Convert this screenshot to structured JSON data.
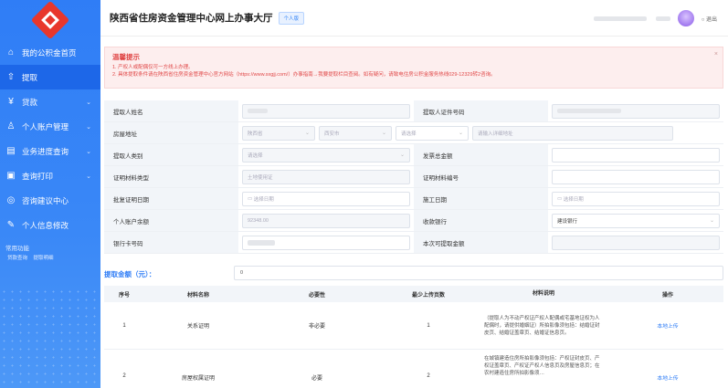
{
  "app": {
    "title": "陕西省住房资金管理中心网上办事大厅",
    "tag": "个人版",
    "logout": "退出"
  },
  "colors": {
    "accent": "#2f7df6",
    "danger": "#e04848",
    "logo": "#e8372c"
  },
  "sidebar": {
    "items": [
      {
        "label": "我的公积金首页",
        "icon": "home-icon",
        "arrow": ""
      },
      {
        "label": "提取",
        "icon": "upload-icon",
        "arrow": ""
      },
      {
        "label": "贷款",
        "icon": "loan-icon",
        "arrow": "⌄"
      },
      {
        "label": "个人账户管理",
        "icon": "user-icon",
        "arrow": "⌄"
      },
      {
        "label": "业务进度查询",
        "icon": "progress-icon",
        "arrow": "⌄"
      },
      {
        "label": "查询打印",
        "icon": "print-icon",
        "arrow": "⌄"
      },
      {
        "label": "咨询建议中心",
        "icon": "chat-icon",
        "arrow": ""
      },
      {
        "label": "个人信息修改",
        "icon": "edit-icon",
        "arrow": ""
      }
    ],
    "common_title": "常用功能",
    "common_links": [
      "贷款查询",
      "提取明细"
    ]
  },
  "notice": {
    "title": "温馨提示",
    "line1": "1. 产权人或配偶仅可一方线上办理。",
    "line2": "2. 具体提取条件请在陕西省住房资金管理中心官方网站（https://www.sxgjj.com/）办事指南→我要提取栏目查阅。如有疑问，请致电住房公积金服务热线029-12329转2咨询。",
    "close": "×"
  },
  "form": {
    "name_label": "提取人姓名",
    "idno_label": "提取人证件号码",
    "address_label": "房屋地址",
    "address": {
      "province": "陕西省",
      "city": "西安市",
      "district": "请选择",
      "detail": "请输入详细地址"
    },
    "type_label": "提取人类别",
    "type_value": "请选择",
    "invoice_label": "发票总金额",
    "cert_type_label": "证明材料类型",
    "cert_type_value": "土地使用证",
    "cert_no_label": "证明材料编号",
    "approve_date_label": "批复证明日期",
    "approve_date_value": "选择日期",
    "build_date_label": "施工日期",
    "build_date_value": "选择日期",
    "balance_label": "个人账户余额",
    "balance_value": "92348.00",
    "bank_label": "收款银行",
    "bank_value": "建设银行",
    "card_label": "银行卡号码",
    "available_label": "本次可提取金额"
  },
  "amount": {
    "label": "提取金额（元）：",
    "value": "0"
  },
  "table": {
    "headers": [
      "序号",
      "材料名称",
      "必要性",
      "最少上传页数",
      "材料说明",
      "操作"
    ],
    "rows": [
      {
        "no": "1",
        "name": "关系证明",
        "necessity": "非必要",
        "pages": "1",
        "desc": "（提取人为不动产权证产权人配偶或宅基地证权为人配偶时，请提供婚姻证）所拍影像须包括：结婚证封皮页、结婚证盖章页、结婚证信息页。",
        "action": "本地上传"
      },
      {
        "no": "2",
        "name": "房屋权属证明",
        "necessity": "必要",
        "pages": "2",
        "desc": "在城镇建造住房所拍影像须包括：产权证封皮页、产权证盖章页、产权证产权人信息页及房屋信息页；在农村建造住房所拍影像须…",
        "action": "本地上传"
      }
    ]
  }
}
